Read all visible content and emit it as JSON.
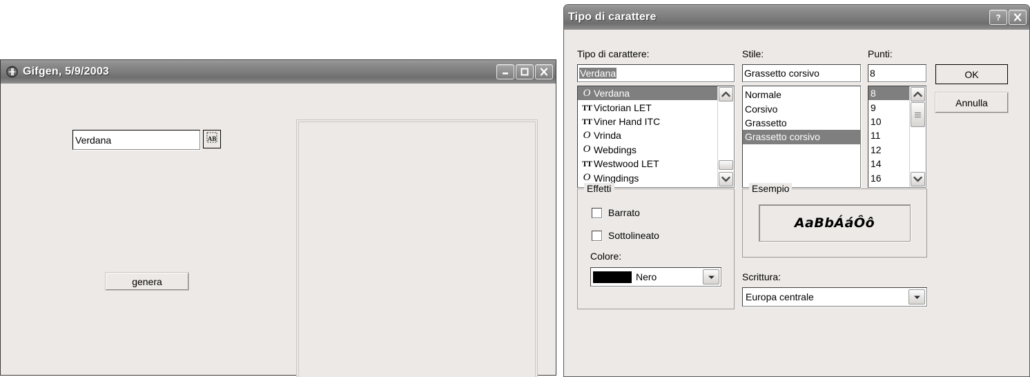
{
  "main_window": {
    "title": "Gifgen, 5/9/2003",
    "app_icon": "font-app-icon",
    "controls": {
      "minimize": "minimize-icon",
      "maximize": "maximize-icon",
      "close": "close-icon"
    },
    "font_input": {
      "value": "Verdana",
      "placeholder": ""
    },
    "font_picker_button": "font-picker-icon",
    "generate_button": "genera",
    "preview_panel": ""
  },
  "font_dialog": {
    "title": "Tipo di carattere",
    "controls": {
      "help": "?",
      "close": "✕"
    },
    "labels": {
      "font": "Tipo di carattere:",
      "style": "Stile:",
      "size": "Punti:",
      "effects": "Effetti",
      "color": "Colore:",
      "sample": "Esempio",
      "script": "Scrittura:"
    },
    "font": {
      "value": "Verdana",
      "selected": "Verdana",
      "items": [
        {
          "name": "Verdana",
          "icon": "O",
          "type": "opentype",
          "selected": true
        },
        {
          "name": "Victorian LET",
          "icon": "TT",
          "type": "truetype",
          "selected": false
        },
        {
          "name": "Viner Hand ITC",
          "icon": "TT",
          "type": "truetype",
          "selected": false
        },
        {
          "name": "Vrinda",
          "icon": "O",
          "type": "opentype",
          "selected": false
        },
        {
          "name": "Webdings",
          "icon": "O",
          "type": "opentype",
          "selected": false
        },
        {
          "name": "Westwood LET",
          "icon": "TT",
          "type": "truetype",
          "selected": false
        },
        {
          "name": "Wingdings",
          "icon": "O",
          "type": "opentype",
          "selected": false
        }
      ]
    },
    "style": {
      "value": "Grassetto corsivo",
      "items": [
        {
          "name": "Normale",
          "selected": false
        },
        {
          "name": "Corsivo",
          "selected": false
        },
        {
          "name": "Grassetto",
          "selected": false
        },
        {
          "name": "Grassetto corsivo",
          "selected": true
        }
      ]
    },
    "size": {
      "value": "8",
      "items": [
        {
          "name": "8",
          "selected": true
        },
        {
          "name": "9",
          "selected": false
        },
        {
          "name": "10",
          "selected": false
        },
        {
          "name": "11",
          "selected": false
        },
        {
          "name": "12",
          "selected": false
        },
        {
          "name": "14",
          "selected": false
        },
        {
          "name": "16",
          "selected": false
        }
      ]
    },
    "buttons": {
      "ok": "OK",
      "cancel": "Annulla"
    },
    "effects": {
      "strikeout": {
        "label": "Barrato",
        "checked": false
      },
      "underline": {
        "label": "Sottolineato",
        "checked": false
      },
      "color": {
        "value": "Nero",
        "swatch": "#000000"
      }
    },
    "sample": {
      "text": "AaBbÁáÔô"
    },
    "script": {
      "value": "Europa centrale"
    }
  },
  "colors": {
    "window_face": "#ece9e6",
    "titlebar_grey": "#7d7d7d",
    "selection_grey": "#7f7f7f",
    "text": "#000000"
  }
}
